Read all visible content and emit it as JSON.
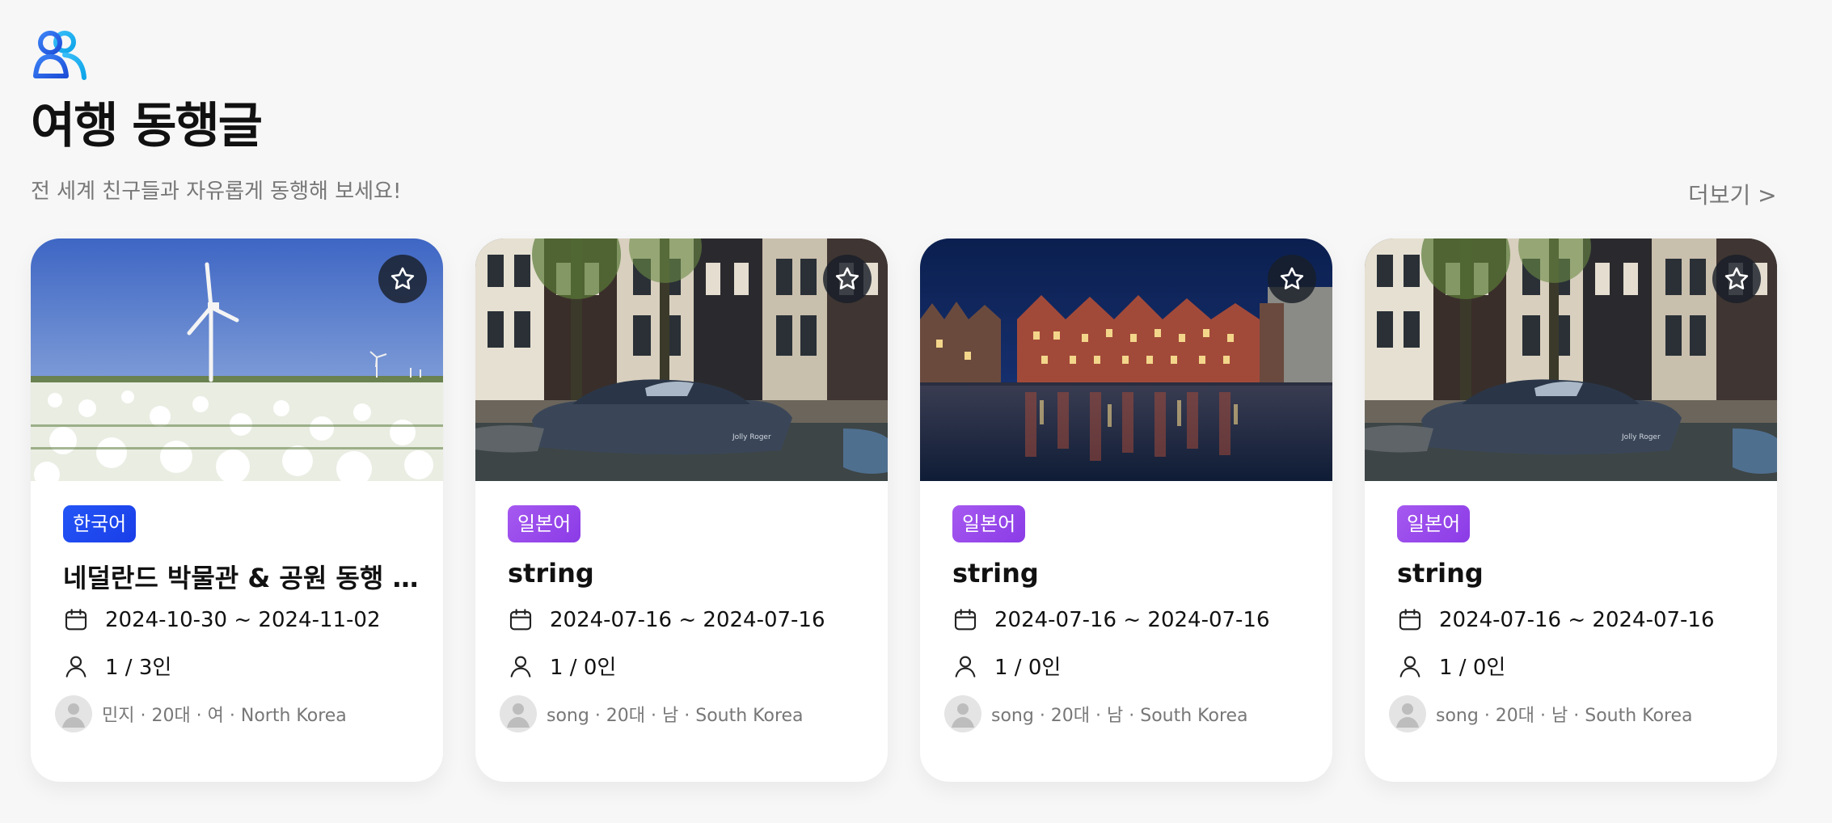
{
  "header": {
    "title": "여행 동행글",
    "subtitle": "전 세계 친구들과 자유롭게 동행해 보세요!",
    "more_label": "더보기 >"
  },
  "colors": {
    "brand_blue": "#2355f6",
    "language_purple": "#a659f0",
    "muted_text": "#777777"
  },
  "cards": [
    {
      "image": "windmill-tulip-field",
      "language": "한국어",
      "language_color": "blue",
      "title": "네덜란드 박물관 & 공원 동행 ...",
      "date_range": "2024-10-30 ~ 2024-11-02",
      "people": "1 / 3인",
      "author": "민지 · 20대 · 여 · North Korea"
    },
    {
      "image": "canal-houses-boat",
      "language": "일본어",
      "language_color": "purple",
      "title": "string",
      "date_range": "2024-07-16 ~ 2024-07-16",
      "people": "1 / 0인",
      "author": "song · 20대 · 남 · South Korea"
    },
    {
      "image": "canal-night-reflection",
      "language": "일본어",
      "language_color": "purple",
      "title": "string",
      "date_range": "2024-07-16 ~ 2024-07-16",
      "people": "1 / 0인",
      "author": "song · 20대 · 남 · South Korea"
    },
    {
      "image": "canal-houses-boat",
      "language": "일본어",
      "language_color": "purple",
      "title": "string",
      "date_range": "2024-07-16 ~ 2024-07-16",
      "people": "1 / 0인",
      "author": "song · 20대 · 남 · South Korea"
    }
  ],
  "icons": {
    "logo": "people-group-icon",
    "favorite": "star-icon",
    "date": "calendar-icon",
    "people": "person-icon",
    "avatar": "default-avatar-icon"
  }
}
